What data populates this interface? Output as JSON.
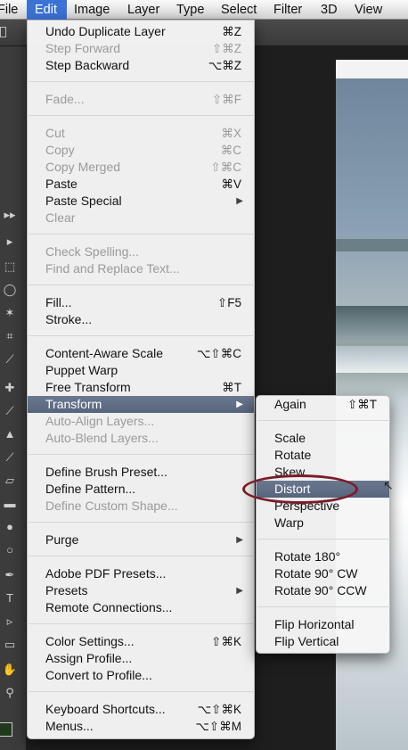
{
  "menubar": {
    "items": [
      "File",
      "Edit",
      "Image",
      "Layer",
      "Type",
      "Select",
      "Filter",
      "3D",
      "View"
    ]
  },
  "edit_menu": {
    "items": [
      {
        "label": "Undo Duplicate Layer",
        "shortcut": "⌘Z",
        "enabled": true
      },
      {
        "label": "Step Forward",
        "shortcut": "⇧⌘Z",
        "enabled": false
      },
      {
        "label": "Step Backward",
        "shortcut": "⌥⌘Z",
        "enabled": true
      },
      {
        "label": "Fade...",
        "shortcut": "⇧⌘F",
        "enabled": false
      },
      {
        "label": "Cut",
        "shortcut": "⌘X",
        "enabled": false
      },
      {
        "label": "Copy",
        "shortcut": "⌘C",
        "enabled": false
      },
      {
        "label": "Copy Merged",
        "shortcut": "⇧⌘C",
        "enabled": false
      },
      {
        "label": "Paste",
        "shortcut": "⌘V",
        "enabled": true
      },
      {
        "label": "Paste Special",
        "shortcut": "",
        "enabled": true
      },
      {
        "label": "Clear",
        "shortcut": "",
        "enabled": false
      },
      {
        "label": "Check Spelling...",
        "shortcut": "",
        "enabled": false
      },
      {
        "label": "Find and Replace Text...",
        "shortcut": "",
        "enabled": false
      },
      {
        "label": "Fill...",
        "shortcut": "⇧F5",
        "enabled": true
      },
      {
        "label": "Stroke...",
        "shortcut": "",
        "enabled": true
      },
      {
        "label": "Content-Aware Scale",
        "shortcut": "⌥⇧⌘C",
        "enabled": true
      },
      {
        "label": "Puppet Warp",
        "shortcut": "",
        "enabled": true
      },
      {
        "label": "Free Transform",
        "shortcut": "⌘T",
        "enabled": true
      },
      {
        "label": "Transform",
        "shortcut": "",
        "enabled": true
      },
      {
        "label": "Auto-Align Layers...",
        "shortcut": "",
        "enabled": false
      },
      {
        "label": "Auto-Blend Layers...",
        "shortcut": "",
        "enabled": false
      },
      {
        "label": "Define Brush Preset...",
        "shortcut": "",
        "enabled": true
      },
      {
        "label": "Define Pattern...",
        "shortcut": "",
        "enabled": true
      },
      {
        "label": "Define Custom Shape...",
        "shortcut": "",
        "enabled": false
      },
      {
        "label": "Purge",
        "shortcut": "",
        "enabled": true
      },
      {
        "label": "Adobe PDF Presets...",
        "shortcut": "",
        "enabled": true
      },
      {
        "label": "Presets",
        "shortcut": "",
        "enabled": true
      },
      {
        "label": "Remote Connections...",
        "shortcut": "",
        "enabled": true
      },
      {
        "label": "Color Settings...",
        "shortcut": "⇧⌘K",
        "enabled": true
      },
      {
        "label": "Assign Profile...",
        "shortcut": "",
        "enabled": true
      },
      {
        "label": "Convert to Profile...",
        "shortcut": "",
        "enabled": true
      },
      {
        "label": "Keyboard Shortcuts...",
        "shortcut": "⌥⇧⌘K",
        "enabled": true
      },
      {
        "label": "Menus...",
        "shortcut": "⌥⇧⌘M",
        "enabled": true
      }
    ]
  },
  "transform_menu": {
    "items": [
      {
        "label": "Again",
        "shortcut": "⇧⌘T"
      },
      {
        "label": "Scale",
        "shortcut": ""
      },
      {
        "label": "Rotate",
        "shortcut": ""
      },
      {
        "label": "Skew",
        "shortcut": ""
      },
      {
        "label": "Distort",
        "shortcut": ""
      },
      {
        "label": "Perspective",
        "shortcut": ""
      },
      {
        "label": "Warp",
        "shortcut": ""
      },
      {
        "label": "Rotate 180°",
        "shortcut": ""
      },
      {
        "label": "Rotate 90° CW",
        "shortcut": ""
      },
      {
        "label": "Rotate 90° CCW",
        "shortcut": ""
      },
      {
        "label": "Flip Horizontal",
        "shortcut": ""
      },
      {
        "label": "Flip Vertical",
        "shortcut": ""
      }
    ]
  },
  "colors": {
    "menu_highlight": "#56647c",
    "menubar_active": "#3b72d6",
    "annotation": "#7a1c2a"
  }
}
